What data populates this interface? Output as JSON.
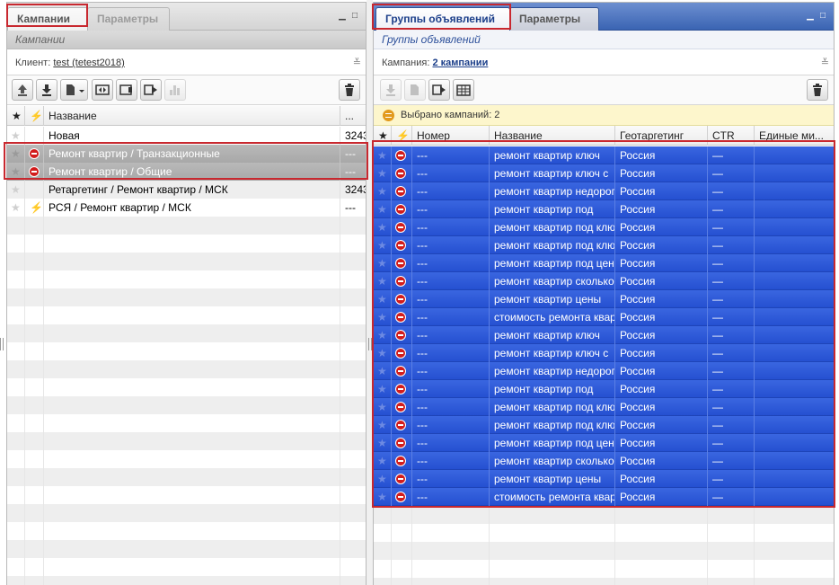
{
  "left": {
    "tabs": [
      {
        "label": "Кампании",
        "active": true
      },
      {
        "label": "Параметры",
        "active": false
      }
    ],
    "subtitle": "Кампании",
    "context": {
      "label": "Клиент:",
      "link": "test (tetest2018)"
    },
    "toolbar": {
      "icons": [
        "upload-icon",
        "download-icon",
        "new-document-icon",
        "copy-arrows-icon",
        "pause-icon",
        "play-icon",
        "stats-bar-icon",
        "trash-icon"
      ]
    },
    "columns": [
      "★",
      "⚡",
      "Название",
      "..."
    ],
    "rows": [
      {
        "status": "",
        "name": "Новая",
        "extra": "3243",
        "selected": false
      },
      {
        "status": "stop",
        "name": "Ремонт квартир / Транзакционные",
        "extra": "---",
        "selected": true
      },
      {
        "status": "stop",
        "name": "Ремонт квартир / Общие",
        "extra": "---",
        "selected": true
      },
      {
        "status": "",
        "name": "Ретаргетинг / Ремонт квартир / МСК",
        "extra": "3243",
        "selected": false
      },
      {
        "status": "bolt",
        "name": "РСЯ / Ремонт квартир / МСК",
        "extra": "---",
        "selected": false
      }
    ]
  },
  "right": {
    "tabs": [
      {
        "label": "Группы объявлений",
        "active": true
      },
      {
        "label": "Параметры",
        "active": false
      }
    ],
    "subtitle": "Группы объявлений",
    "context": {
      "label": "Кампания:",
      "link": "2 кампании"
    },
    "notice": "Выбрано кампаний: 2",
    "toolbar": {
      "icons": [
        "download-icon",
        "new-document-icon",
        "play-icon",
        "table-icon",
        "trash-icon"
      ]
    },
    "columns": [
      "★",
      "⚡▲",
      "Номер",
      "Название",
      "Геотаргетинг",
      "CTR",
      "Единые ми..."
    ],
    "rows": [
      {
        "num": "---",
        "name": "ремонт квартир ключ",
        "geo": "Россия",
        "ctr": "—"
      },
      {
        "num": "---",
        "name": "ремонт квартир ключ с",
        "geo": "Россия",
        "ctr": "—"
      },
      {
        "num": "---",
        "name": "ремонт квартир недорого",
        "geo": "Россия",
        "ctr": "—"
      },
      {
        "num": "---",
        "name": "ремонт квартир под",
        "geo": "Россия",
        "ctr": "—"
      },
      {
        "num": "---",
        "name": "ремонт квартир под ключ",
        "geo": "Россия",
        "ctr": "—"
      },
      {
        "num": "---",
        "name": "ремонт квартир под ключ",
        "geo": "Россия",
        "ctr": "—"
      },
      {
        "num": "---",
        "name": "ремонт квартир под цена",
        "geo": "Россия",
        "ctr": "—"
      },
      {
        "num": "---",
        "name": "ремонт квартир сколько",
        "geo": "Россия",
        "ctr": "—"
      },
      {
        "num": "---",
        "name": "ремонт квартир цены",
        "geo": "Россия",
        "ctr": "—"
      },
      {
        "num": "---",
        "name": "стоимость ремонта квартир",
        "geo": "Россия",
        "ctr": "—"
      },
      {
        "num": "---",
        "name": "ремонт квартир ключ",
        "geo": "Россия",
        "ctr": "—"
      },
      {
        "num": "---",
        "name": "ремонт квартир ключ с",
        "geo": "Россия",
        "ctr": "—"
      },
      {
        "num": "---",
        "name": "ремонт квартир недорого",
        "geo": "Россия",
        "ctr": "—"
      },
      {
        "num": "---",
        "name": "ремонт квартир под",
        "geo": "Россия",
        "ctr": "—"
      },
      {
        "num": "---",
        "name": "ремонт квартир под ключ",
        "geo": "Россия",
        "ctr": "—"
      },
      {
        "num": "---",
        "name": "ремонт квартир под ключ",
        "geo": "Россия",
        "ctr": "—"
      },
      {
        "num": "---",
        "name": "ремонт квартир под цена",
        "geo": "Россия",
        "ctr": "—"
      },
      {
        "num": "---",
        "name": "ремонт квартир сколько",
        "geo": "Россия",
        "ctr": "—"
      },
      {
        "num": "---",
        "name": "ремонт квартир цены",
        "geo": "Россия",
        "ctr": "—"
      },
      {
        "num": "---",
        "name": "стоимость ремонта квартир",
        "geo": "Россия",
        "ctr": "—"
      }
    ]
  },
  "colors": {
    "selection_blue": "#2f5cd9",
    "selection_gray": "#b0b0b0",
    "highlight_red": "#c8282f",
    "stop_red": "#d21c1c",
    "notice_bg": "#fdf6cc"
  }
}
